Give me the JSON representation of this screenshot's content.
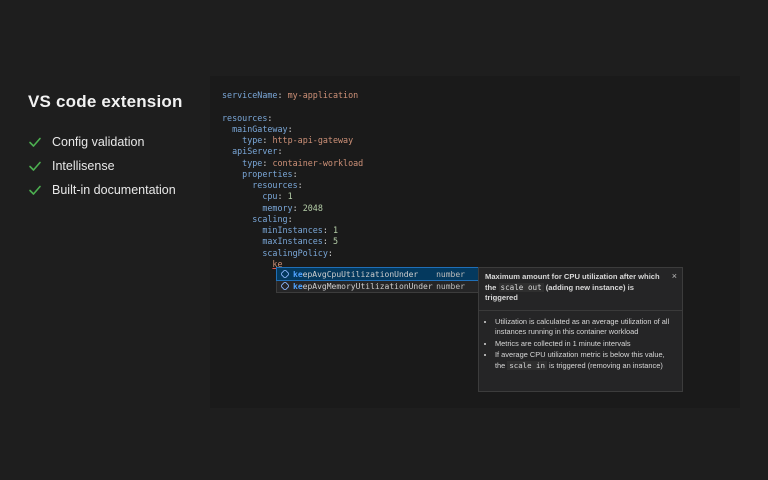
{
  "left": {
    "title": "VS code extension",
    "features": [
      "Config validation",
      "Intellisense",
      "Built-in documentation"
    ],
    "check_color": "#4caf50"
  },
  "editor": {
    "lines": [
      {
        "indent": "",
        "key": "serviceName",
        "value": "my-application",
        "vtype": "s"
      },
      {
        "indent": "",
        "key": "",
        "value": "",
        "vtype": "s"
      },
      {
        "indent": "",
        "key": "resources",
        "value": "",
        "vtype": "s"
      },
      {
        "indent": "  ",
        "key": "mainGateway",
        "value": "",
        "vtype": "s"
      },
      {
        "indent": "    ",
        "key": "type",
        "value": "http-api-gateway",
        "vtype": "s"
      },
      {
        "indent": "  ",
        "key": "apiServer",
        "value": "",
        "vtype": "s"
      },
      {
        "indent": "    ",
        "key": "type",
        "value": "container-workload",
        "vtype": "s"
      },
      {
        "indent": "    ",
        "key": "properties",
        "value": "",
        "vtype": "s"
      },
      {
        "indent": "      ",
        "key": "resources",
        "value": "",
        "vtype": "s"
      },
      {
        "indent": "        ",
        "key": "cpu",
        "value": "1",
        "vtype": "n"
      },
      {
        "indent": "        ",
        "key": "memory",
        "value": "2048",
        "vtype": "n"
      },
      {
        "indent": "      ",
        "key": "scaling",
        "value": "",
        "vtype": "s"
      },
      {
        "indent": "        ",
        "key": "minInstances",
        "value": "1",
        "vtype": "n"
      },
      {
        "indent": "        ",
        "key": "maxInstances",
        "value": "5",
        "vtype": "n"
      },
      {
        "indent": "        ",
        "key": "scalingPolicy",
        "value": "",
        "vtype": "s"
      }
    ],
    "typed_text": "ke",
    "typed_indent": "          "
  },
  "suggestions": [
    {
      "match": "ke",
      "rest": "epAvgCpuUtilizationUnder",
      "type": "number",
      "active": true
    },
    {
      "match": "ke",
      "rest": "epAvgMemoryUtilizationUnder",
      "type": "number",
      "active": false
    }
  ],
  "docs": {
    "close_icon": "×",
    "header_part1": "Maximum amount for CPU utilization after which the ",
    "header_code": "scale out",
    "header_part2": " (adding new instance) is triggered",
    "bullet1": "Utilization is calculated as an average utilization of all instances running in this container workload",
    "bullet2": "Metrics are collected in 1 minute intervals",
    "bullet3_part1": "If average CPU utilization metric is below this value, the ",
    "bullet3_code": "scale in",
    "bullet3_part2": " is triggered (removing an instance)"
  }
}
